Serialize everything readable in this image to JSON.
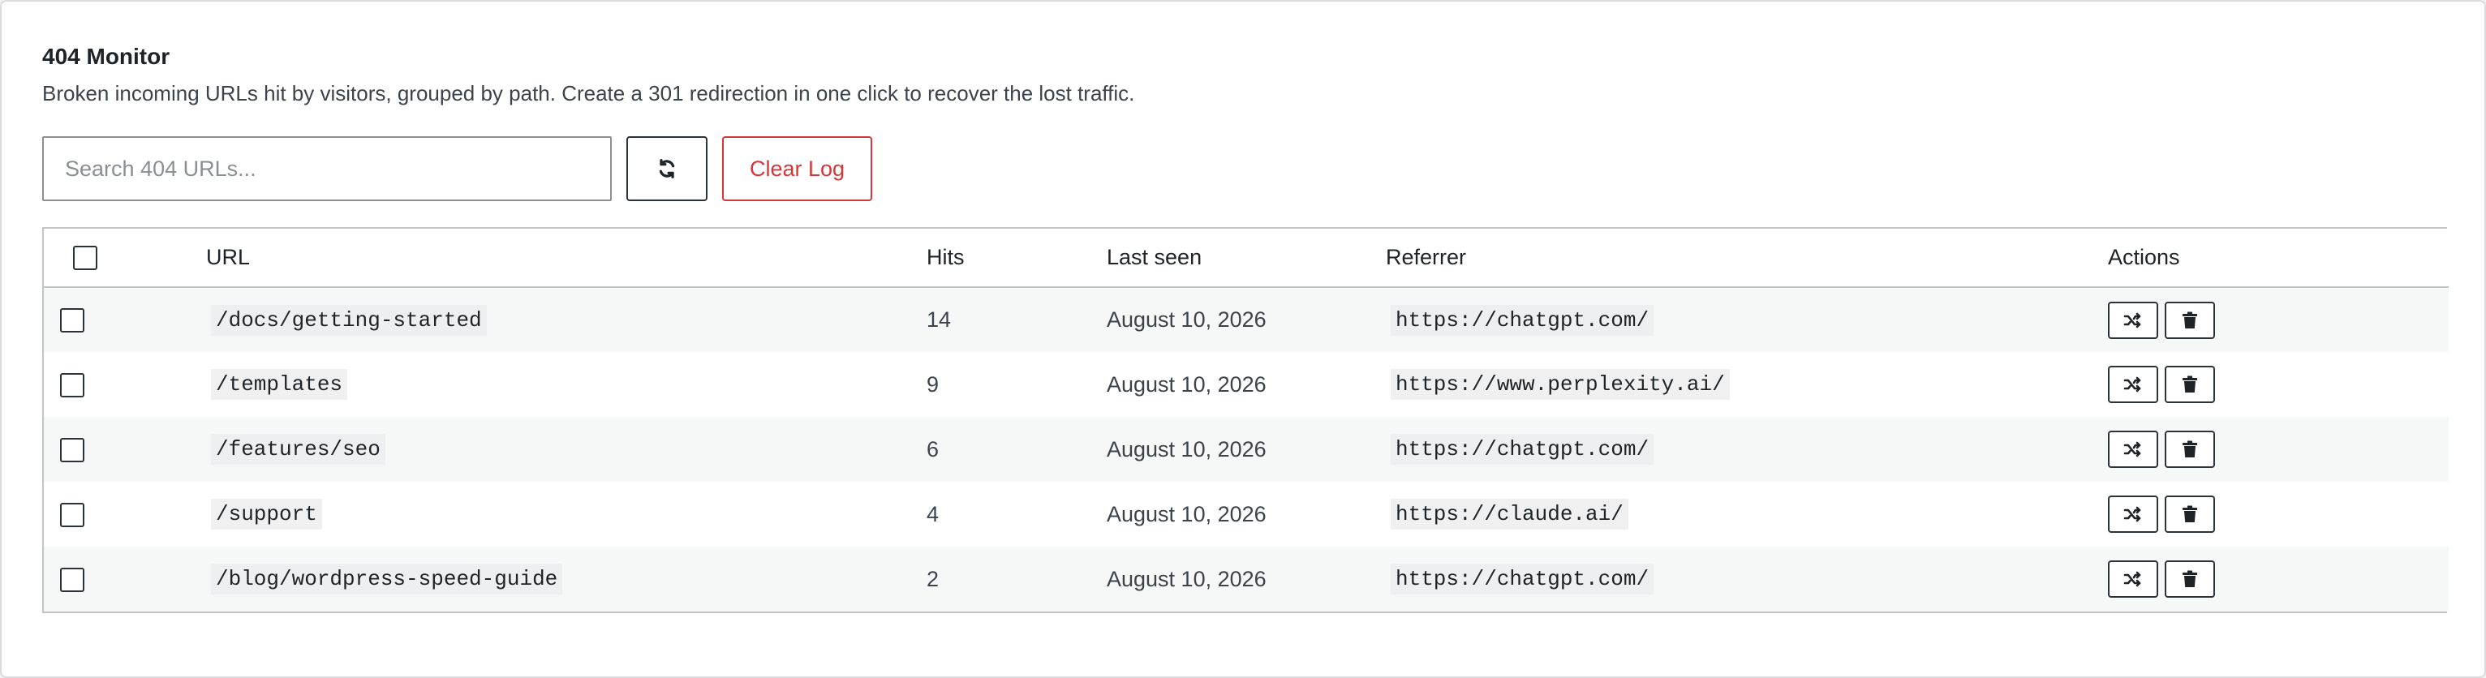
{
  "header": {
    "title": "404 Monitor",
    "description": "Broken incoming URLs hit by visitors, grouped by path. Create a 301 redirection in one click to recover the lost traffic."
  },
  "toolbar": {
    "search_placeholder": "Search 404 URLs...",
    "search_value": "",
    "refresh_icon": "refresh-icon",
    "clear_label": "Clear Log"
  },
  "table": {
    "columns": {
      "url": "URL",
      "hits": "Hits",
      "last_seen": "Last seen",
      "referrer": "Referrer",
      "actions": "Actions"
    },
    "rows": [
      {
        "url": "/docs/getting-started",
        "hits": "14",
        "last_seen": "August 10, 2026",
        "referrer": "https://chatgpt.com/"
      },
      {
        "url": "/templates",
        "hits": "9",
        "last_seen": "August 10, 2026",
        "referrer": "https://www.perplexity.ai/"
      },
      {
        "url": "/features/seo",
        "hits": "6",
        "last_seen": "August 10, 2026",
        "referrer": "https://chatgpt.com/"
      },
      {
        "url": "/support",
        "hits": "4",
        "last_seen": "August 10, 2026",
        "referrer": "https://claude.ai/"
      },
      {
        "url": "/blog/wordpress-speed-guide",
        "hits": "2",
        "last_seen": "August 10, 2026",
        "referrer": "https://chatgpt.com/"
      }
    ],
    "row_actions": [
      "redirect-shuffle-icon",
      "trash-icon"
    ]
  },
  "colors": {
    "danger": "#d63638",
    "text": "#1d2327",
    "border": "#c3c4c7",
    "stripe": "#f6f7f7"
  }
}
